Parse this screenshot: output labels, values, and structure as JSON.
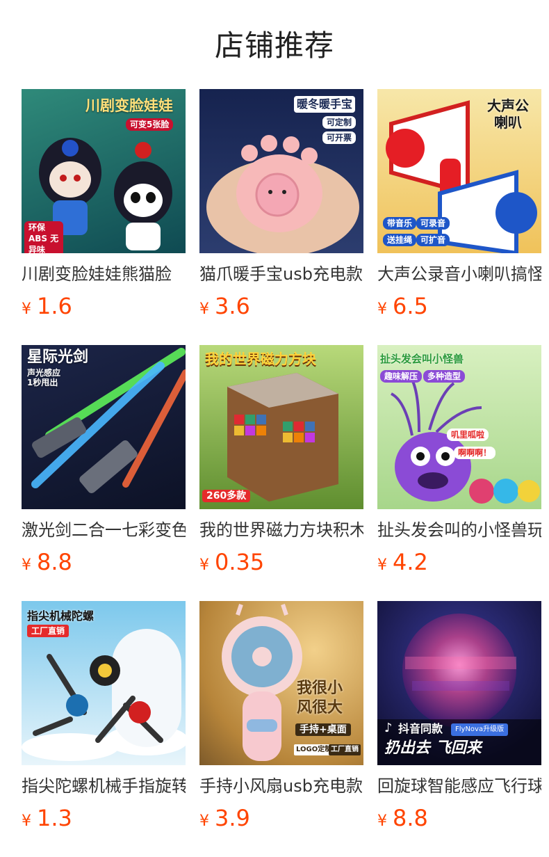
{
  "section_title": "店铺推荐",
  "products": [
    {
      "name": "川剧变脸娃娃熊猫脸",
      "currency": "¥",
      "price": "1.6",
      "bg": "#1f6d67",
      "overlay": {
        "title": "川剧变脸娃娃",
        "tag1": "可变5张脸",
        "tag2": "环保ABS 无异味"
      }
    },
    {
      "name": "猫爪暖手宝usb充电款",
      "currency": "¥",
      "price": "3.6",
      "bg": "#1b2a55",
      "overlay": {
        "title": "暖冬暖手宝",
        "tag1": "可定制",
        "tag2": "可开票"
      }
    },
    {
      "name": "大声公录音小喇叭搞怪",
      "currency": "¥",
      "price": "6.5",
      "bg": "#f2c45a",
      "overlay": {
        "title": "大声公 喇叭",
        "tag1": "带音乐",
        "tag2": "可录音",
        "tag3": "送挂绳",
        "tag4": "可扩音"
      }
    },
    {
      "name": "激光剑二合一七彩变色",
      "currency": "¥",
      "price": "8.8",
      "bg": "#141b3c",
      "overlay": {
        "title": "星际光剑",
        "sub1": "声光感应",
        "sub2": "1秒甩出"
      }
    },
    {
      "name": "我的世界磁力方块积木",
      "currency": "¥",
      "price": "0.35",
      "bg": "#6f9a3f",
      "overlay": {
        "title": "我的世界磁力方块",
        "tag1": "260多款"
      }
    },
    {
      "name": "扯头发会叫的小怪兽玩具",
      "currency": "¥",
      "price": "4.2",
      "bg": "#bfe3a3",
      "overlay": {
        "title": "扯头发会叫小怪兽",
        "tag1": "趣味解压",
        "tag2": "多种造型",
        "bubble1": "叽里呱啦",
        "bubble2": "啊啊啊！"
      }
    },
    {
      "name": "指尖陀螺机械手指旋转",
      "currency": "¥",
      "price": "1.3",
      "bg": "#5ab8e0",
      "overlay": {
        "title": "指尖机械陀螺",
        "tag1": "工厂直销"
      }
    },
    {
      "name": "手持小风扇usb充电款",
      "currency": "¥",
      "price": "3.9",
      "bg": "#d9a45a",
      "overlay": {
        "title": "我很小 风很大",
        "tag1": "手持+桌面",
        "tag2": "LOGO定制",
        "tag3": "工厂直销"
      }
    },
    {
      "name": "回旋球智能感应飞行球",
      "currency": "¥",
      "price": "8.8",
      "bg": "#2a2a72",
      "overlay": {
        "title": "扔出去 飞回来",
        "tag1": "抖音同款",
        "tag2": "FlyNova升级版"
      }
    }
  ]
}
